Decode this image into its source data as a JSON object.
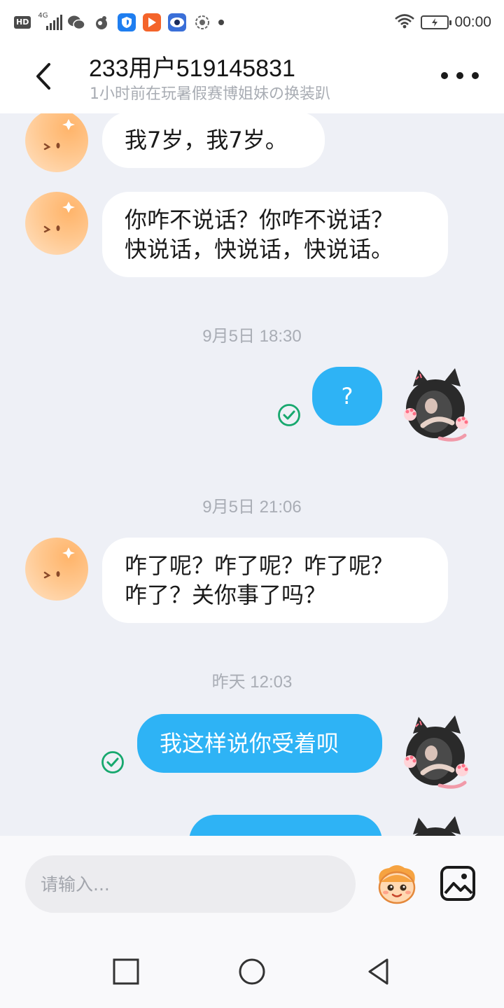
{
  "status_bar": {
    "hd_label": "HD",
    "network_label": "4G",
    "time": "00:00",
    "icons": [
      "hd-icon",
      "signal-4g-icon",
      "wechat-icon",
      "app-icon",
      "shield-app-icon",
      "video-app-icon",
      "eye-app-icon",
      "record-icon",
      "more-notifications-dot",
      "wifi-icon",
      "battery-charging-icon"
    ]
  },
  "header": {
    "title": "233用户519145831",
    "subtitle": "1小时前在玩暑假赛博姐妹の换装趴",
    "back_icon": "chevron-left-icon",
    "more_icon": "more-horizontal-icon"
  },
  "messages": [
    {
      "type": "text",
      "direction": "in",
      "text": "我7岁，我7岁。"
    },
    {
      "type": "text",
      "direction": "in",
      "lines": [
        "你咋不说话？你咋不说话？",
        "快说话，快说话，快说话。"
      ]
    },
    {
      "type": "time",
      "text": "9月5日 18:30"
    },
    {
      "type": "text",
      "direction": "out",
      "text": "?",
      "status": "read"
    },
    {
      "type": "time",
      "text": "9月5日 21:06"
    },
    {
      "type": "text",
      "direction": "in",
      "lines": [
        "咋了呢？咋了呢？咋了呢？",
        "咋了？关你事了吗？"
      ]
    },
    {
      "type": "time",
      "text": "昨天 12:03"
    },
    {
      "type": "text",
      "direction": "out",
      "text": "我这样说你受着呗",
      "status": "read"
    }
  ],
  "input": {
    "placeholder": "请输入..."
  },
  "colors": {
    "background": "#eef0f6",
    "outgoing_bubble": "#2eb3f5",
    "incoming_bubble": "#ffffff",
    "read_check": "#17a86e",
    "timestamp": "#a9adb5"
  },
  "nav": {
    "icons": [
      "recent-apps-square-icon",
      "home-circle-icon",
      "back-triangle-icon"
    ]
  }
}
